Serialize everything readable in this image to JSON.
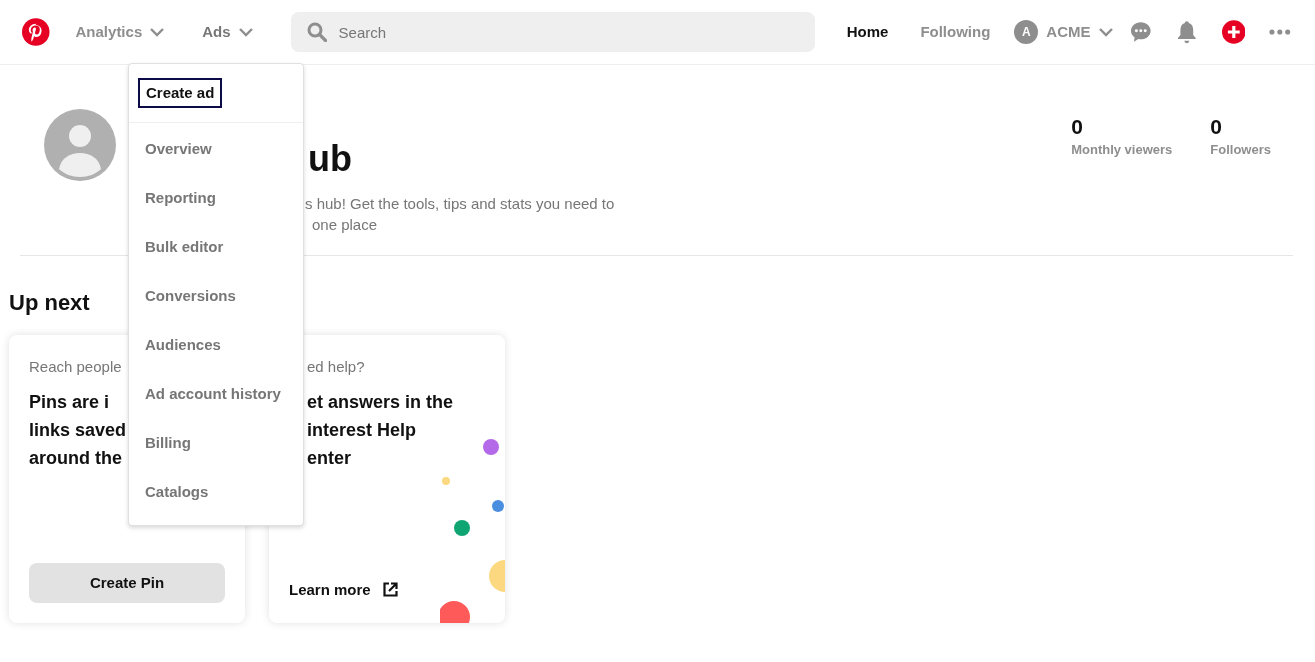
{
  "header": {
    "nav": [
      {
        "label": "Analytics",
        "selected": false
      },
      {
        "label": "Ads",
        "selected": true
      }
    ],
    "search": {
      "placeholder": "Search"
    },
    "tabs": [
      {
        "label": "Home",
        "selected": true
      },
      {
        "label": "Following",
        "selected": false
      }
    ],
    "account": {
      "initial": "A",
      "name": "ACME"
    }
  },
  "ads_menu": {
    "items": [
      {
        "label": "Create ad",
        "focused": true
      },
      {
        "label": "Overview",
        "focused": false
      },
      {
        "label": "Reporting",
        "focused": false
      },
      {
        "label": "Bulk editor",
        "focused": false
      },
      {
        "label": "Conversions",
        "focused": false
      },
      {
        "label": "Audiences",
        "focused": false
      },
      {
        "label": "Ad account history",
        "focused": false
      },
      {
        "label": "Billing",
        "focused": false
      },
      {
        "label": "Catalogs",
        "focused": false
      }
    ]
  },
  "hub": {
    "title": "ub",
    "description": [
      "s hub! Get the tools, tips and stats you need to",
      "one place"
    ],
    "stats": [
      {
        "value": "0",
        "label": "Monthly viewers"
      },
      {
        "value": "0",
        "label": "Followers"
      }
    ]
  },
  "up_next": {
    "heading": "Up next",
    "cards": [
      {
        "kind": "pin",
        "eyebrow": "Reach people",
        "lines": [
          "Pins are i",
          "links saved",
          "around the"
        ],
        "action": "Create Pin"
      },
      {
        "kind": "help",
        "eyebrow": "ed help?",
        "lines": [
          "et answers in the",
          "interest Help",
          "enter"
        ],
        "action": "Learn more"
      }
    ]
  }
}
